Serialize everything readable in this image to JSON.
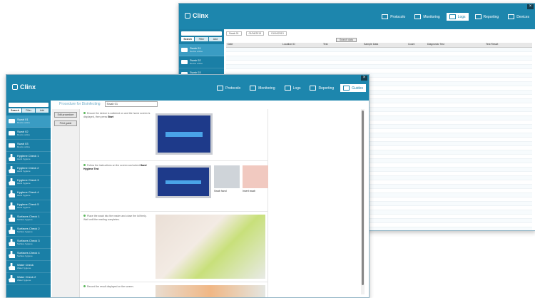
{
  "back_window": {
    "app_name": "Clinx",
    "close": "×",
    "nav": [
      {
        "label": "Protocolo",
        "icon": "document-icon",
        "active": false
      },
      {
        "label": "Monitoring",
        "icon": "monitor-icon",
        "active": false
      },
      {
        "label": "Logs",
        "icon": "list-icon",
        "active": true
      },
      {
        "label": "Reporting",
        "icon": "chart-icon",
        "active": false
      },
      {
        "label": "Devices",
        "icon": "device-icon",
        "active": false
      }
    ],
    "sidebar": {
      "tabs": [
        "Search",
        "Filter",
        "Add"
      ],
      "items": [
        {
          "name": "Swab 01",
          "sub": "Device online"
        },
        {
          "name": "Swab 02",
          "sub": "Device online"
        },
        {
          "name": "Swab 03",
          "sub": "Device online"
        }
      ]
    },
    "filters": {
      "device": "Swab 01",
      "from": "01/04/2013",
      "to": "01/04/2013",
      "find": "Search data"
    },
    "table": {
      "headers": [
        "Date",
        "Location ID",
        "Test",
        "Sample Data",
        "Count",
        "Diagnostic Test",
        "Test Result"
      ]
    }
  },
  "front_window": {
    "app_name": "Clinx",
    "close": "×",
    "nav": [
      {
        "label": "Protocolo",
        "icon": "document-icon",
        "active": false
      },
      {
        "label": "Monitoring",
        "icon": "monitor-icon",
        "active": false
      },
      {
        "label": "Logs",
        "icon": "list-icon",
        "active": false
      },
      {
        "label": "Reporting",
        "icon": "chart-icon",
        "active": false
      },
      {
        "label": "Guides",
        "icon": "book-icon",
        "active": true
      }
    ],
    "sidebar": {
      "tabs": [
        "Search",
        "Filter",
        "Add"
      ],
      "items": [
        {
          "name": "Swab 01",
          "sub": "Device online",
          "type": "device"
        },
        {
          "name": "Swab 02",
          "sub": "Device online",
          "type": "device"
        },
        {
          "name": "Swab 03",
          "sub": "Device online",
          "type": "device"
        },
        {
          "name": "Hygiene Check 1",
          "sub": "Hand hygiene",
          "type": "hand"
        },
        {
          "name": "Hygiene Check 2",
          "sub": "Hand hygiene",
          "type": "hand"
        },
        {
          "name": "Hygiene Check 3",
          "sub": "Hand hygiene",
          "type": "hand"
        },
        {
          "name": "Hygiene Check 4",
          "sub": "Hand hygiene",
          "type": "hand"
        },
        {
          "name": "Hygiene Check 5",
          "sub": "Hand hygiene",
          "type": "hand"
        },
        {
          "name": "Surfaces Check 1",
          "sub": "Surface hygiene",
          "type": "hand"
        },
        {
          "name": "Surfaces Check 2",
          "sub": "Surface hygiene",
          "type": "hand"
        },
        {
          "name": "Surfaces Check 3",
          "sub": "Surface hygiene",
          "type": "hand"
        },
        {
          "name": "Surfaces Check 4",
          "sub": "Surface hygiene",
          "type": "hand"
        },
        {
          "name": "Water Check",
          "sub": "Water hygiene",
          "type": "hand"
        },
        {
          "name": "Water Check 2",
          "sub": "Water hygiene",
          "type": "hand"
        }
      ]
    },
    "toolbar": {
      "title": "Procedure for Disinfecting",
      "select": "Swab 01"
    },
    "left_buttons": [
      "Edit procedure",
      "Print guide"
    ],
    "steps": [
      {
        "text": "Ensure the device is switched on and the home screen is displayed, then press",
        "bold": "Start"
      },
      {
        "text": "Follow the instructions on the screen and select",
        "bold": "Hand Hygiene Test",
        "caption1": "Swab hand",
        "caption2": "Insert swab"
      },
      {
        "text": "Place the swab into the reader and close the lid firmly. Wait until the reading completes.",
        "bold": ""
      },
      {
        "text": "Record the result displayed on the screen.",
        "bold": ""
      }
    ]
  },
  "colors": {
    "brand": "#1d86ad",
    "sidebar": "#1a7fa6",
    "active": "#ffffff"
  }
}
